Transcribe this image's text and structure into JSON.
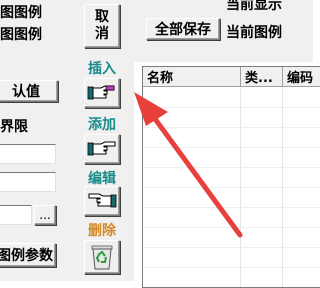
{
  "left_panel": {
    "row1": "图图例",
    "row2": "图图例",
    "default_button": "认值",
    "boundary_label": "界限",
    "browse_button": "...",
    "legend_params_button": "图例参数"
  },
  "middle": {
    "cancel_button": "取\n消",
    "insert_label": "插入",
    "add_label": "添加",
    "edit_label": "编辑",
    "delete_label": "删除"
  },
  "right": {
    "status_top": "当前显示",
    "save_all_button": "全部保存",
    "current_legend": "当前图例",
    "columns": [
      "名称",
      "类...",
      "编码"
    ]
  },
  "colors": {
    "insert_label": "#1a8a8a",
    "add_label": "#1a8a8a",
    "edit_label": "#1a8a8a",
    "delete_label": "#d08a2a",
    "arrow": "#e8413c"
  }
}
